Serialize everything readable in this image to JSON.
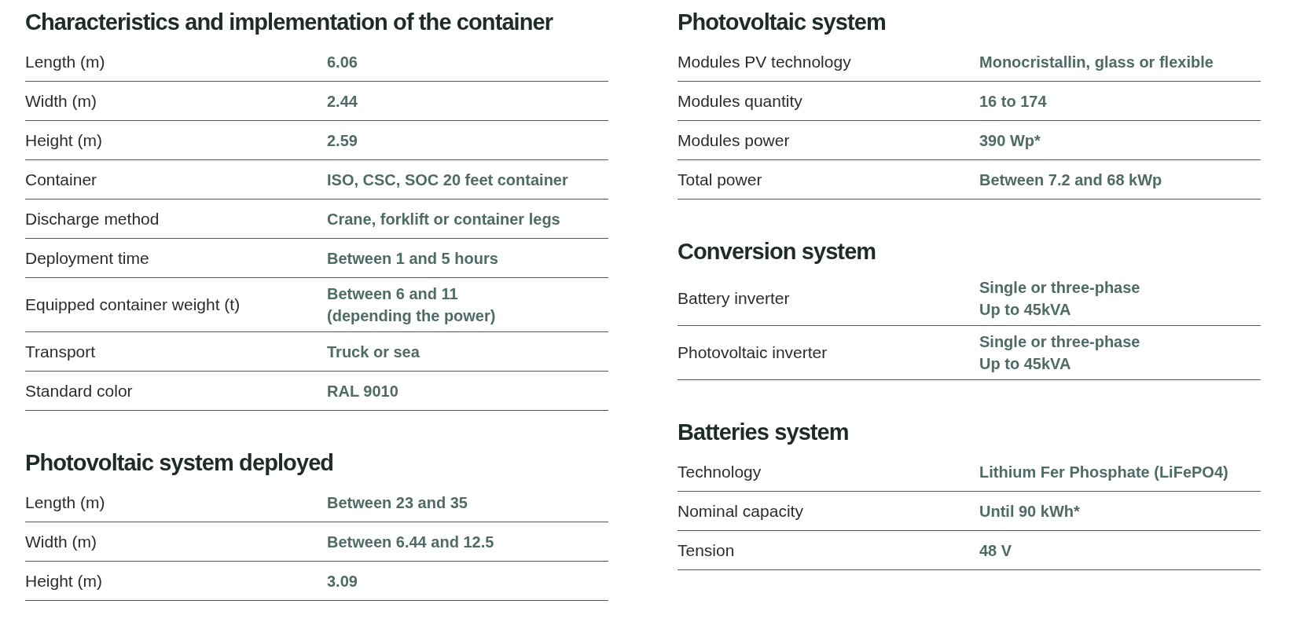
{
  "columns": [
    {
      "sections": [
        {
          "title": "Characteristics and implementation of the container",
          "rows": [
            {
              "label": "Length (m)",
              "value": "6.06"
            },
            {
              "label": "Width (m)",
              "value": "2.44"
            },
            {
              "label": "Height (m)",
              "value": "2.59"
            },
            {
              "label": "Container",
              "value": "ISO, CSC, SOC 20 feet container"
            },
            {
              "label": "Discharge method",
              "value": "Crane, forklift or container legs"
            },
            {
              "label": "Deployment time",
              "value": "Between 1 and 5 hours"
            },
            {
              "label": "Equipped container weight (t)",
              "value": "Between 6 and 11\n(depending the power)"
            },
            {
              "label": "Transport",
              "value": "Truck or sea"
            },
            {
              "label": "Standard color",
              "value": "RAL 9010"
            }
          ]
        },
        {
          "title": "Photovoltaic system deployed",
          "rows": [
            {
              "label": "Length (m)",
              "value": "Between 23 and 35"
            },
            {
              "label": "Width (m)",
              "value": "Between 6.44 and 12.5"
            },
            {
              "label": "Height (m)",
              "value": "3.09"
            }
          ]
        }
      ]
    },
    {
      "sections": [
        {
          "title": "Photovoltaic system",
          "rows": [
            {
              "label": "Modules PV technology",
              "value": "Monocristallin, glass or flexible"
            },
            {
              "label": "Modules quantity",
              "value": "16 to 174"
            },
            {
              "label": "Modules power",
              "value": "390 Wp*"
            },
            {
              "label": "Total power",
              "value": "Between 7.2 and 68 kWp"
            }
          ]
        },
        {
          "title": "Conversion system",
          "rows": [
            {
              "label": "Battery inverter",
              "value": "Single or three-phase\nUp to 45kVA"
            },
            {
              "label": "Photovoltaic inverter",
              "value": "Single or three-phase\nUp to 45kVA"
            }
          ]
        },
        {
          "title": "Batteries system",
          "rows": [
            {
              "label": "Technology",
              "value": "Lithium Fer Phosphate (LiFePO4)"
            },
            {
              "label": "Nominal capacity",
              "value": "Until 90 kWh*"
            },
            {
              "label": "Tension",
              "value": "48 V"
            }
          ]
        }
      ]
    }
  ]
}
